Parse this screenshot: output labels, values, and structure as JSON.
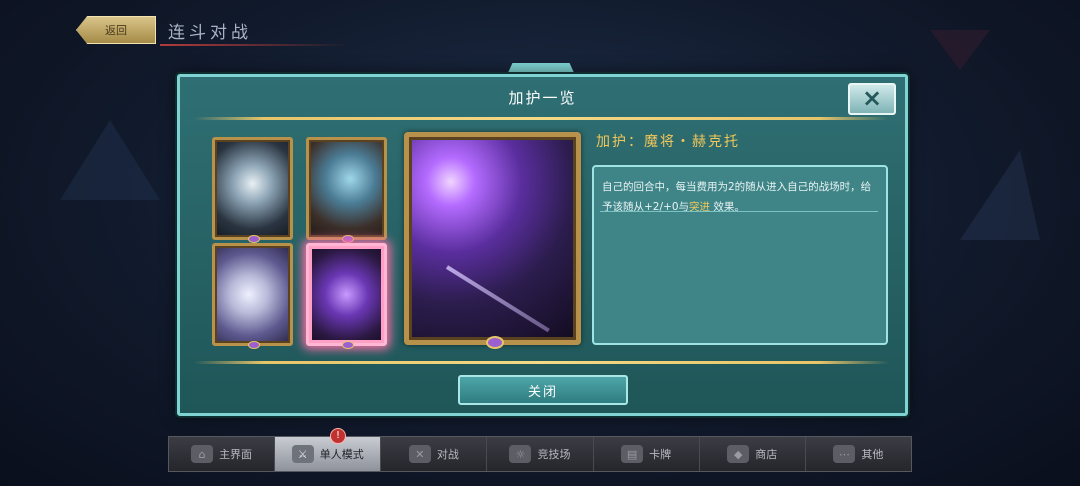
{
  "topbar": {
    "back_label": "返回",
    "title": "连斗对战"
  },
  "modal": {
    "title": "加护一览",
    "close_icon": "×",
    "buff_name": "加护：魔将・赫克托",
    "description_before": "自己的回合中，每当费用为2的随从进入自己的战场时，给予该随从+2/+0与",
    "description_keyword": "突进",
    "description_after": "效果。",
    "close_button": "关闭"
  },
  "cards": [
    {
      "name": "card-1",
      "selected": false
    },
    {
      "name": "card-2",
      "selected": false
    },
    {
      "name": "card-3",
      "selected": false
    },
    {
      "name": "card-4",
      "selected": true
    }
  ],
  "bottom_nav": [
    {
      "label": "主界面",
      "icon": "house-icon",
      "glyph": "⌂",
      "active": false
    },
    {
      "label": "单人模式",
      "icon": "sword-icon",
      "glyph": "⚔",
      "active": true
    },
    {
      "label": "对战",
      "icon": "crossed-swords-icon",
      "glyph": "✕",
      "active": false
    },
    {
      "label": "竞技场",
      "icon": "arena-icon",
      "glyph": "☼",
      "active": false
    },
    {
      "label": "卡牌",
      "icon": "cards-icon",
      "glyph": "▤",
      "active": false
    },
    {
      "label": "商店",
      "icon": "shop-icon",
      "glyph": "◆",
      "active": false
    },
    {
      "label": "其他",
      "icon": "more-icon",
      "glyph": "⋯",
      "active": false
    }
  ],
  "badge": "!",
  "colors": {
    "gold": "#f0c75a",
    "panel": "#2f6f73",
    "accent": "#7fd4d3"
  }
}
